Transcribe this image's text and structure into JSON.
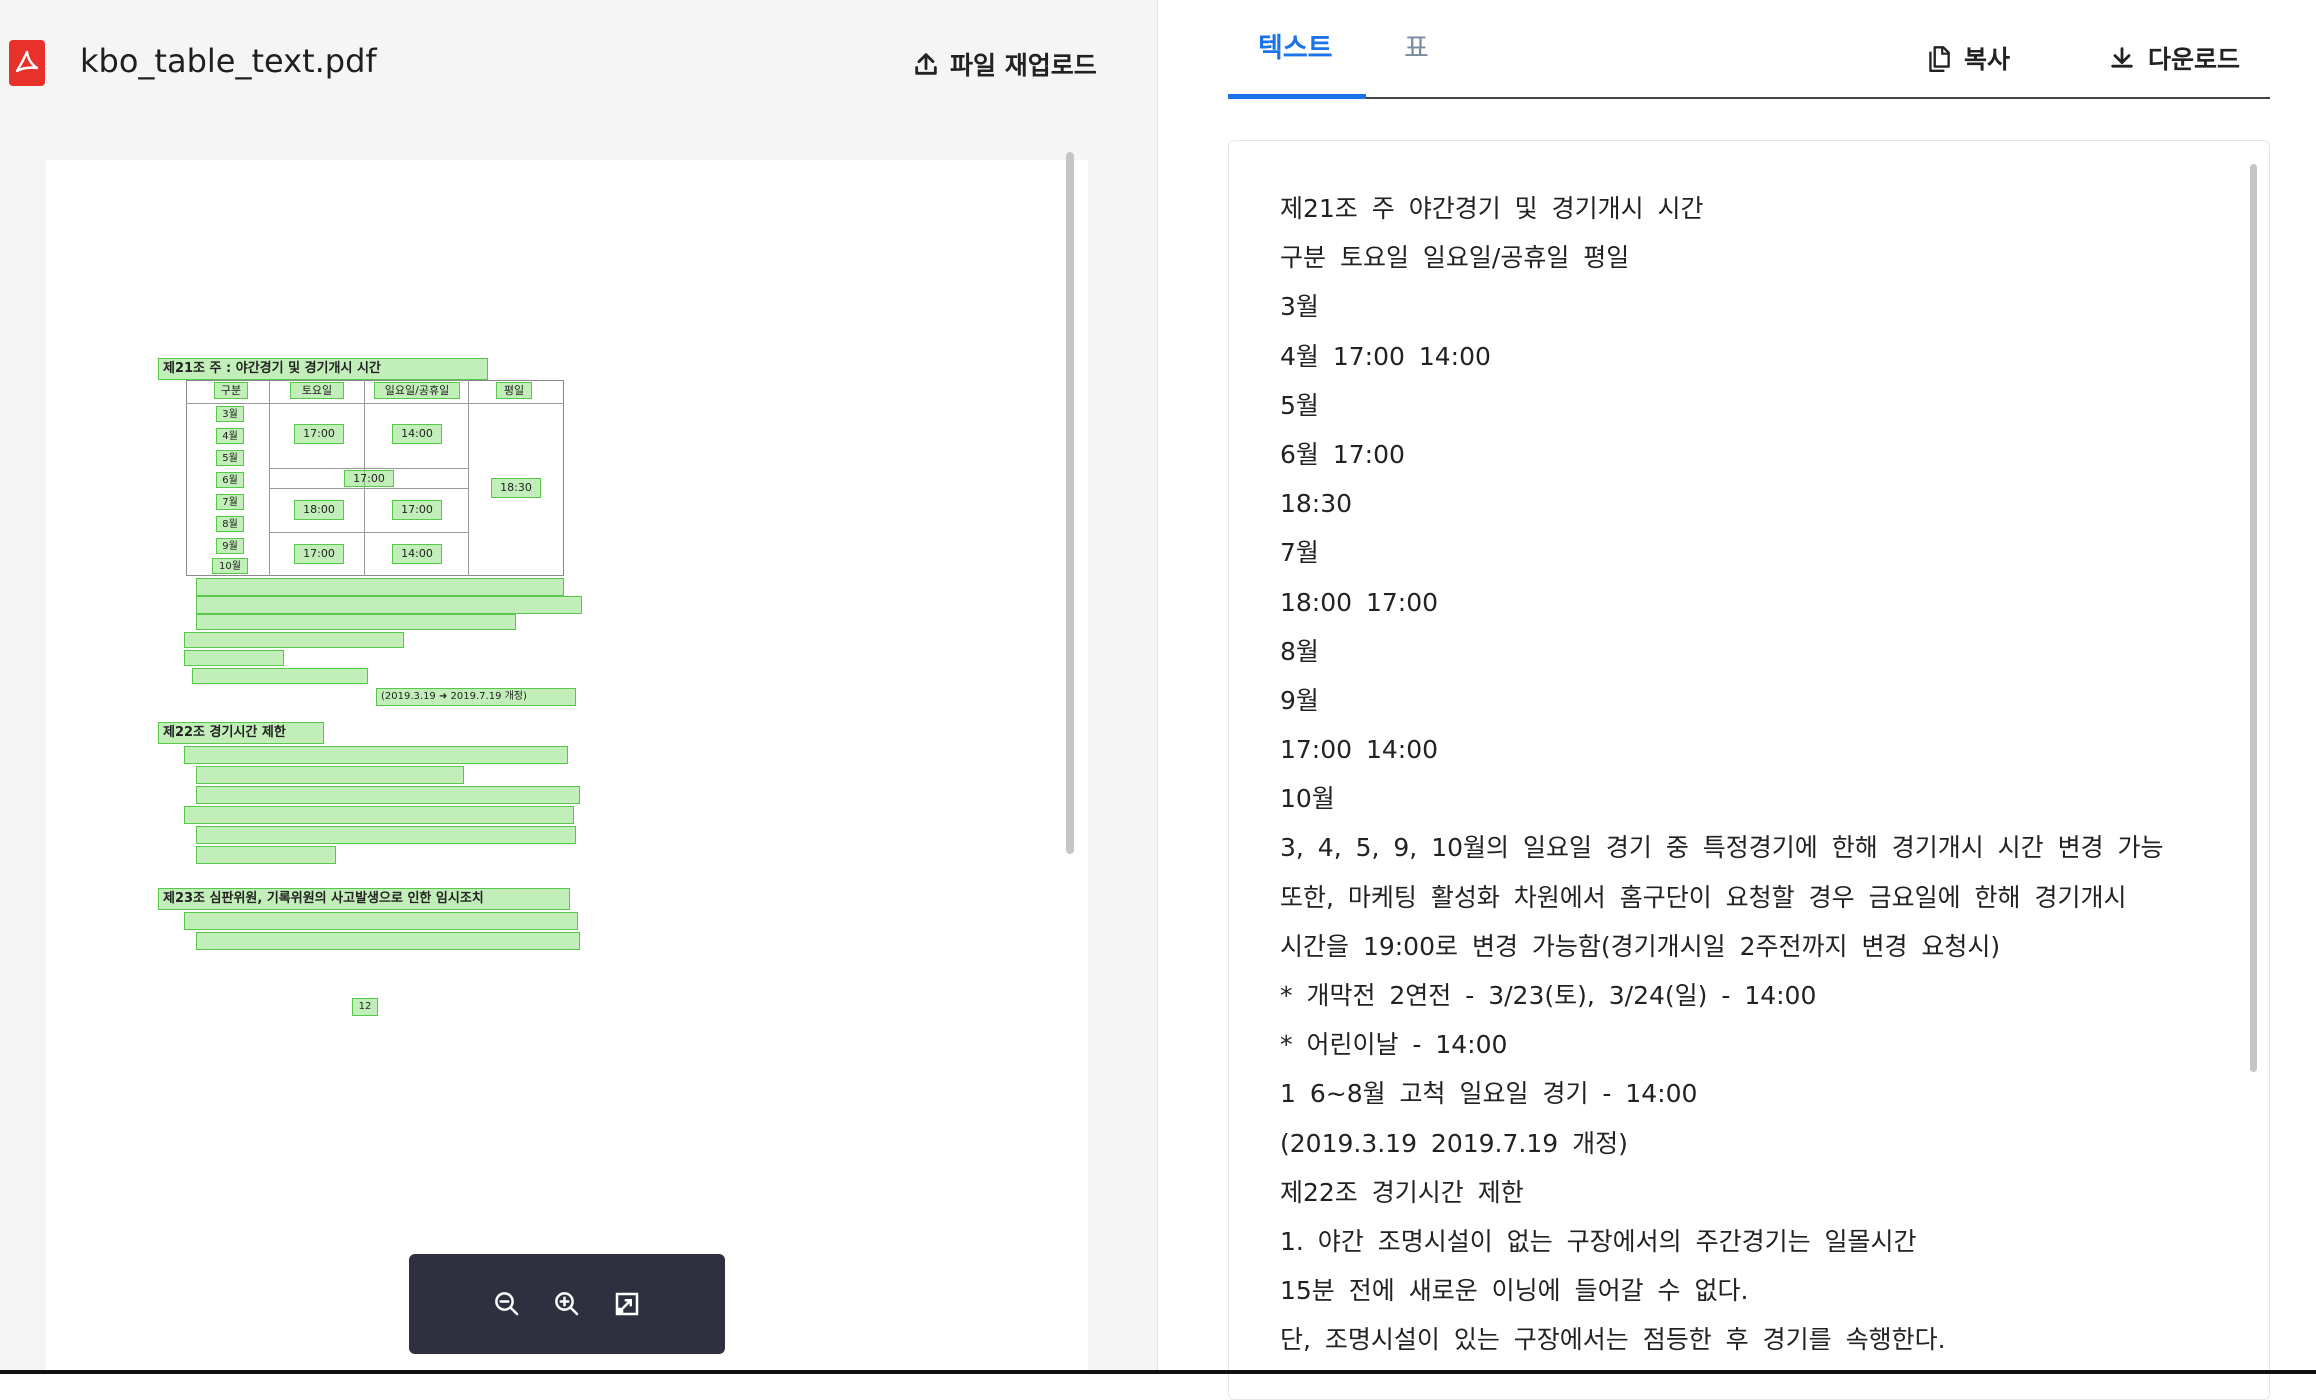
{
  "file": {
    "name": "kbo_table_text.pdf",
    "icon": "pdf-icon"
  },
  "actions": {
    "reupload_label": "파일 재업로드",
    "copy_label": "복사",
    "download_label": "다운로드"
  },
  "tabs": [
    {
      "label": "텍스트",
      "active": true
    },
    {
      "label": "표",
      "active": false
    }
  ],
  "colors": {
    "accent": "#1a73e8",
    "pdf": "#e8312a",
    "ocr_highlight": "#78dc64",
    "zoombar": "#2e3040"
  },
  "zoom_toolbar": {
    "icons": [
      "zoom-out-icon",
      "zoom-in-icon",
      "fit-page-icon"
    ]
  },
  "extracted_text": [
    "제21조 주 야간경기 및 경기개시 시간",
    "구분 토요일 일요일/공휴일 평일",
    "3월",
    "4월 17:00 14:00",
    "5월",
    "6월 17:00",
    "18:30",
    "7월",
    "18:00 17:00",
    "8월",
    "9월",
    "17:00 14:00",
    "10월",
    "3, 4, 5, 9, 10월의 일요일 경기 중 특정경기에 한해 경기개시 시간 변경 가능",
    "또한, 마케팅 활성화 차원에서 홈구단이 요청할 경우 금요일에 한해 경기개시",
    "시간을 19:00로 변경 가능함(경기개시일 2주전까지 변경 요청시)",
    "* 개막전 2연전 - 3/23(토), 3/24(일) - 14:00",
    "* 어린이날 - 14:00",
    "1 6~8월 고척 일요일 경기 - 14:00",
    "(2019.3.19 2019.7.19 개정)",
    "제22조 경기시간 제한",
    "1. 야간 조명시설이 없는 구장에서의 주간경기는 일몰시간",
    "15분 전에 새로운 이닝에 들어갈 수 없다.",
    "단, 조명시설이 있는 구장에서는 점등한 후 경기를 속행한다."
  ],
  "pdf_preview": {
    "heading1": "제21조 주 : 야간경기 및 경기개시 시간",
    "headers": [
      "구분",
      "토요일",
      "일요일/공휴일",
      "평일"
    ],
    "months": [
      "3월",
      "4월",
      "5월",
      "6월",
      "7월",
      "8월",
      "9월",
      "10월"
    ],
    "cell_1700a": "17:00",
    "cell_1400a": "14:00",
    "cell_1700b": "17:00",
    "cell_1830": "18:30",
    "cell_1800": "18:00",
    "cell_1700c": "17:00",
    "cell_1700d": "17:00",
    "cell_1400b": "14:00",
    "revision": "(2019.3.19 ➜ 2019.7.19 개정)",
    "heading2": "제22조 경기시간 제한",
    "heading3": "제23조 심판위원, 기록위원의 사고발생으로 인한 임시조치",
    "page_number": "12"
  }
}
